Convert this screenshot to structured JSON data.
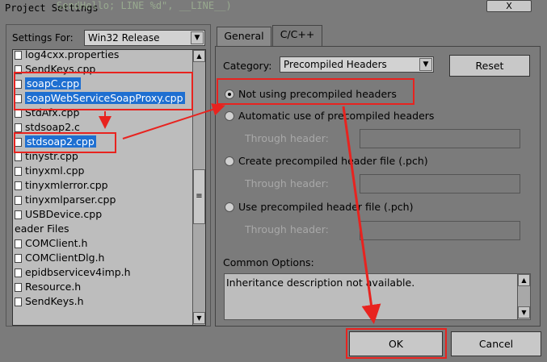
{
  "window": {
    "title": "Project Settings",
    "ghost_text": "SendHello; LINE %d\", __LINE__)",
    "close_label": "X"
  },
  "left": {
    "settings_for_label": "Settings For:",
    "config_value": "Win32 Release",
    "files": [
      {
        "name": "log4cxx.properties",
        "selected": false
      },
      {
        "name": "SendKeys.cpp",
        "selected": false
      },
      {
        "name": "soapC.cpp",
        "selected": true
      },
      {
        "name": "soapWebServiceSoapProxy.cpp",
        "selected": true
      },
      {
        "name": "StdAfx.cpp",
        "selected": false
      },
      {
        "name": "stdsoap2.c",
        "selected": false
      },
      {
        "name": "stdsoap2.cpp",
        "selected": true
      },
      {
        "name": "tinystr.cpp",
        "selected": false
      },
      {
        "name": "tinyxml.cpp",
        "selected": false
      },
      {
        "name": "tinyxmlerror.cpp",
        "selected": false
      },
      {
        "name": "tinyxmlparser.cpp",
        "selected": false
      },
      {
        "name": "USBDevice.cpp",
        "selected": false
      },
      {
        "name": "eader Files",
        "selected": false,
        "folder": true
      },
      {
        "name": "COMClient.h",
        "selected": false
      },
      {
        "name": "COMClientDlg.h",
        "selected": false
      },
      {
        "name": "epidbservicev4imp.h",
        "selected": false
      },
      {
        "name": "Resource.h",
        "selected": false
      },
      {
        "name": "SendKeys.h",
        "selected": false
      }
    ]
  },
  "tabs": [
    {
      "label": "General",
      "active": false
    },
    {
      "label": "C/C++",
      "active": true
    }
  ],
  "right": {
    "category_label": "Category:",
    "category_value": "Precompiled Headers",
    "reset_label": "Reset",
    "options": [
      {
        "label": "Not using precompiled headers",
        "checked": true
      },
      {
        "label": "Automatic use of precompiled headers",
        "checked": false
      },
      {
        "label": "Create precompiled header file (.pch)",
        "checked": false
      },
      {
        "label": "Use precompiled header file (.pch)",
        "checked": false
      }
    ],
    "through_header_label": "Through header:",
    "common_options_label": "Common Options:",
    "common_options_text": "Inheritance description not available."
  },
  "footer": {
    "ok_label": "OK",
    "cancel_label": "Cancel"
  },
  "colors": {
    "annotation": "#e8231f",
    "selection": "#1e6fd1"
  }
}
